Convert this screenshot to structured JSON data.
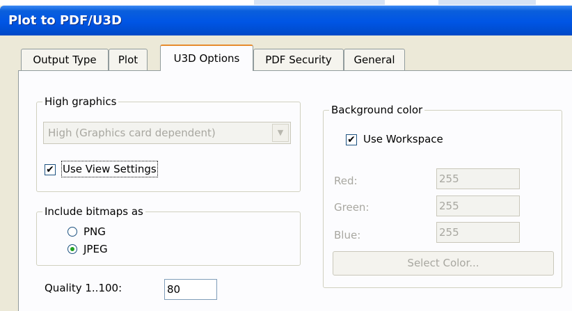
{
  "window": {
    "title": "Plot to PDF/U3D"
  },
  "tabs": [
    {
      "label": "Output Type"
    },
    {
      "label": "Plot"
    },
    {
      "label": "U3D Options"
    },
    {
      "label": "PDF Security"
    },
    {
      "label": "General"
    }
  ],
  "active_tab": "U3D Options",
  "high_graphics": {
    "legend": "High graphics",
    "select_value": "High (Graphics card dependent)",
    "use_view_settings_label": "Use View Settings",
    "use_view_settings_checked": true
  },
  "bitmaps": {
    "legend": "Include bitmaps as",
    "options": [
      {
        "label": "PNG",
        "selected": false
      },
      {
        "label": "JPEG",
        "selected": true
      }
    ]
  },
  "quality": {
    "label": "Quality 1..100:",
    "value": "80"
  },
  "background": {
    "legend": "Background color",
    "use_workspace_label": "Use Workspace",
    "use_workspace_checked": true,
    "red_label": "Red:",
    "red_value": "255",
    "green_label": "Green:",
    "green_value": "255",
    "blue_label": "Blue:",
    "blue_value": "255",
    "select_color_label": "Select Color..."
  },
  "checkmark_glyph": "✔",
  "colors": {
    "title_bar": "#0055e5",
    "active_tab_accent": "#e68b2c",
    "dialog_bg": "#ece9d8"
  }
}
